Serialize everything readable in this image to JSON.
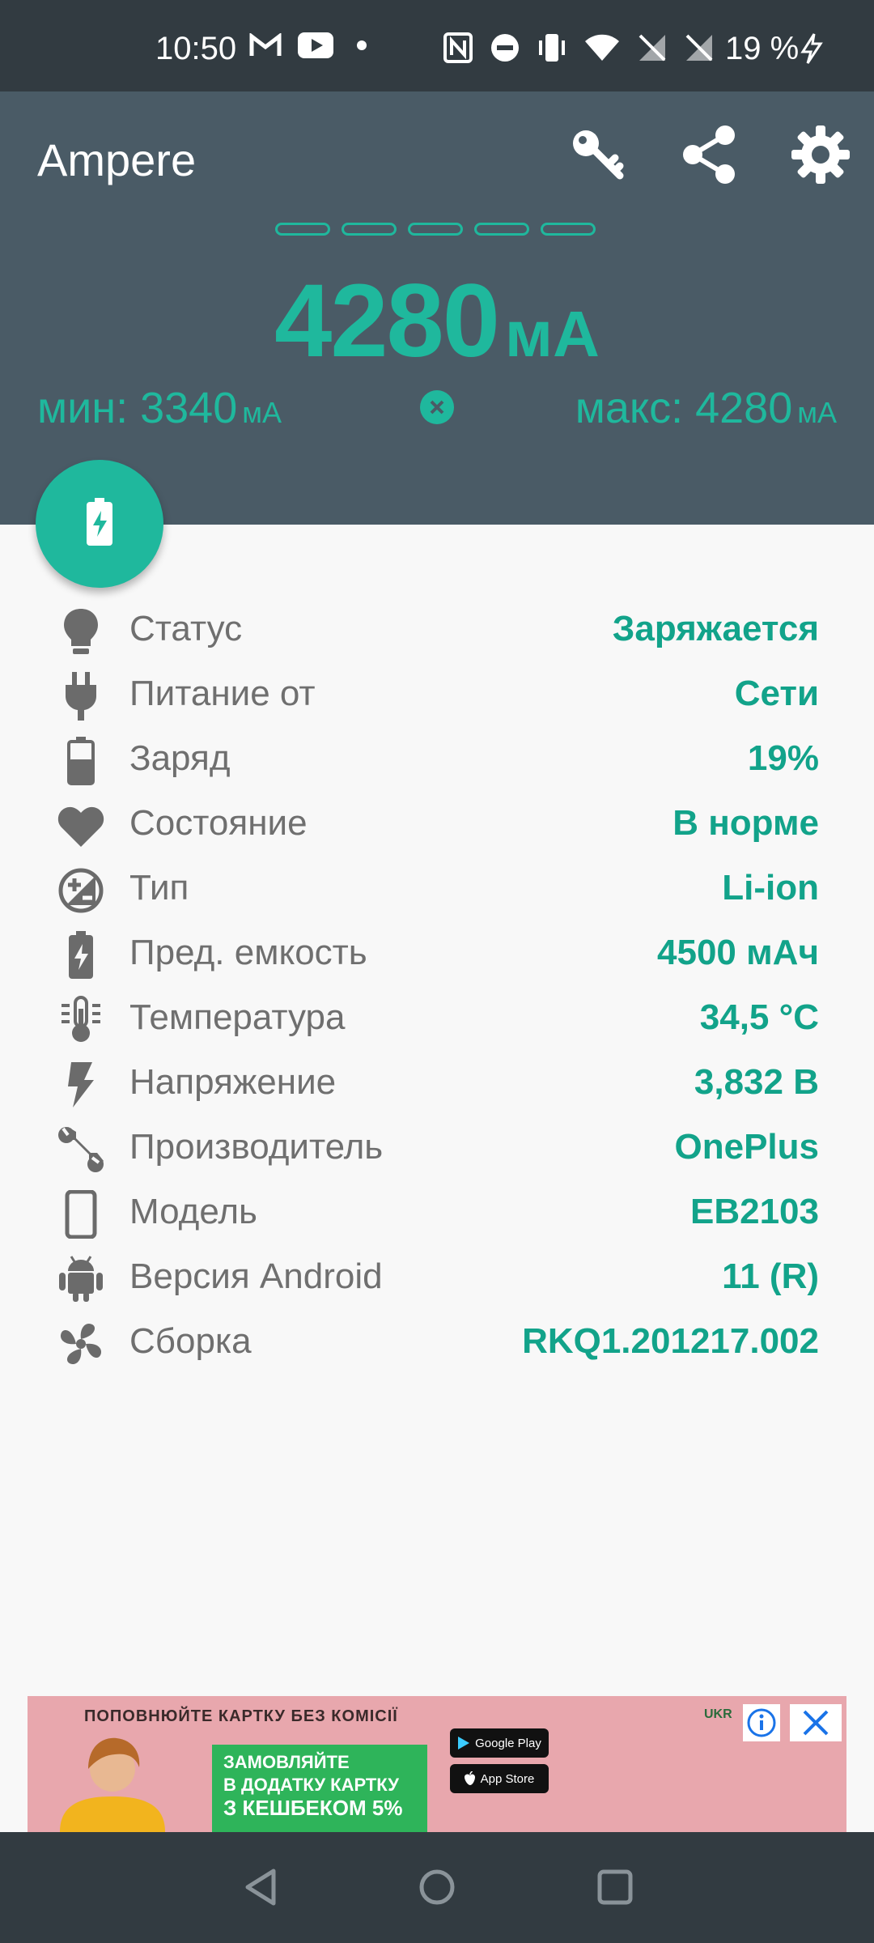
{
  "status_bar": {
    "time": "10:50",
    "battery_percent": "19 %",
    "left_icons": [
      "gmail-icon",
      "youtube-icon",
      "dot-icon"
    ],
    "right_icons": [
      "nfc-icon",
      "dnd-icon",
      "vibrate-icon",
      "wifi-icon",
      "no-sim-icon",
      "no-sim-icon",
      "charging-bolt-icon"
    ]
  },
  "header": {
    "title": "Ampere",
    "actions": [
      "key-icon",
      "share-icon",
      "settings-icon"
    ],
    "current_value": "4280",
    "current_unit": "мА",
    "min_label": "мин: 3340",
    "min_unit": "мА",
    "max_label": "макс: 4280",
    "max_unit": "мА"
  },
  "fab": {
    "icon": "battery-charging-icon"
  },
  "info": [
    {
      "icon": "bulb-icon",
      "label": "Статус",
      "value": "Заряжается"
    },
    {
      "icon": "plug-icon",
      "label": "Питание от",
      "value": "Сети"
    },
    {
      "icon": "battery-icon",
      "label": "Заряд",
      "value": "19%"
    },
    {
      "icon": "heart-icon",
      "label": "Состояние",
      "value": "В норме"
    },
    {
      "icon": "plus-minus-icon",
      "label": "Тип",
      "value": "Li-ion"
    },
    {
      "icon": "battery-bolt-icon",
      "label": "Пред. емкость",
      "value": "4500 мАч"
    },
    {
      "icon": "thermometer-icon",
      "label": "Температура",
      "value": "34,5 °C"
    },
    {
      "icon": "bolt-icon",
      "label": "Напряжение",
      "value": "3,832 В"
    },
    {
      "icon": "wrench-icon",
      "label": "Производитель",
      "value": "OnePlus"
    },
    {
      "icon": "phone-icon",
      "label": "Модель",
      "value": "EB2103"
    },
    {
      "icon": "android-icon",
      "label": "Версия Android",
      "value": "11 (R)"
    },
    {
      "icon": "fan-icon",
      "label": "Сборка",
      "value": "RKQ1.201217.002"
    }
  ],
  "ad": {
    "headline": "ПОПОВНЮЙТЕ КАРТКУ БЕЗ КОМІСІЇ",
    "green_line1": "ЗАМОВЛЯЙТЕ",
    "green_line2": "В ДОДАТКУ КАРТКУ",
    "green_line3": "З КЕШБЕКОМ 5%",
    "google_play": "Google Play",
    "app_store": "App Store",
    "logo": "UKR"
  },
  "colors": {
    "accent": "#1fb89d",
    "header_bg": "#4a5b66",
    "status_bg": "#323b41",
    "value_text": "#12a38a",
    "label_text": "#6f6f6f",
    "icon_gray": "#6b6b6b"
  }
}
